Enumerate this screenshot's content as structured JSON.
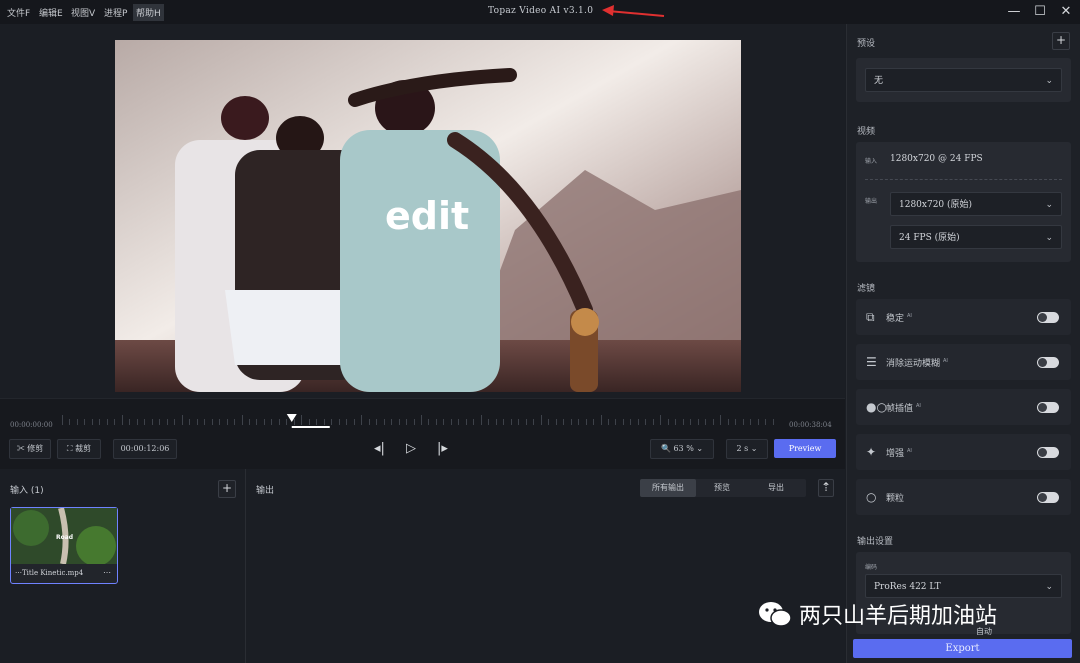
{
  "menu": [
    "文件F",
    "编辑E",
    "视图V",
    "进程P",
    "帮助H"
  ],
  "app_title": "Topaz Video AI  v3.1.0",
  "accent": "#5a6cf0",
  "annotation_color": "#e03030",
  "preview": {
    "overlay_text": "edit"
  },
  "timeline": {
    "start": "00:00:00:00",
    "end": "00:00:38:04",
    "trim_label": "修剪",
    "crop_label": "裁剪",
    "current_time": "00:00:12:06",
    "zoom": "63 %",
    "speed": "2 s",
    "preview_label": "Preview",
    "playhead_fraction": 0.32
  },
  "input": {
    "title": "输入 (1)",
    "clip_name": "⋯Title Kinetic.mp4",
    "thumb_label": "Road"
  },
  "output": {
    "title": "输出",
    "tabs": [
      "所有输出",
      "预览",
      "导出"
    ]
  },
  "sidebar": {
    "presets_title": "预设",
    "preset_value": "无",
    "video_title": "视频",
    "input_label": "输入",
    "input_spec": "1280x720 @ 24 FPS",
    "output_label": "输出",
    "resolution": "1280x720 (原始)",
    "fps": "24 FPS (原始)",
    "filters_title": "滤镜",
    "filters": [
      {
        "label": "稳定",
        "ai": "AI",
        "icon": "stabilize-icon"
      },
      {
        "label": "消除运动模糊",
        "ai": "AI",
        "icon": "motion-deblur-icon"
      },
      {
        "label": "帧插值",
        "ai": "AI",
        "icon": "frame-interpolation-icon"
      },
      {
        "label": "增强",
        "ai": "AI",
        "icon": "enhance-icon"
      },
      {
        "label": "颗粒",
        "ai": "",
        "icon": "grain-icon"
      }
    ],
    "output_settings_title": "输出设置",
    "codec_label": "编码",
    "codec_value": "ProRes 422 LT",
    "partial_text": "自动",
    "export_label": "Export"
  },
  "watermark": "两只山羊后期加油站"
}
